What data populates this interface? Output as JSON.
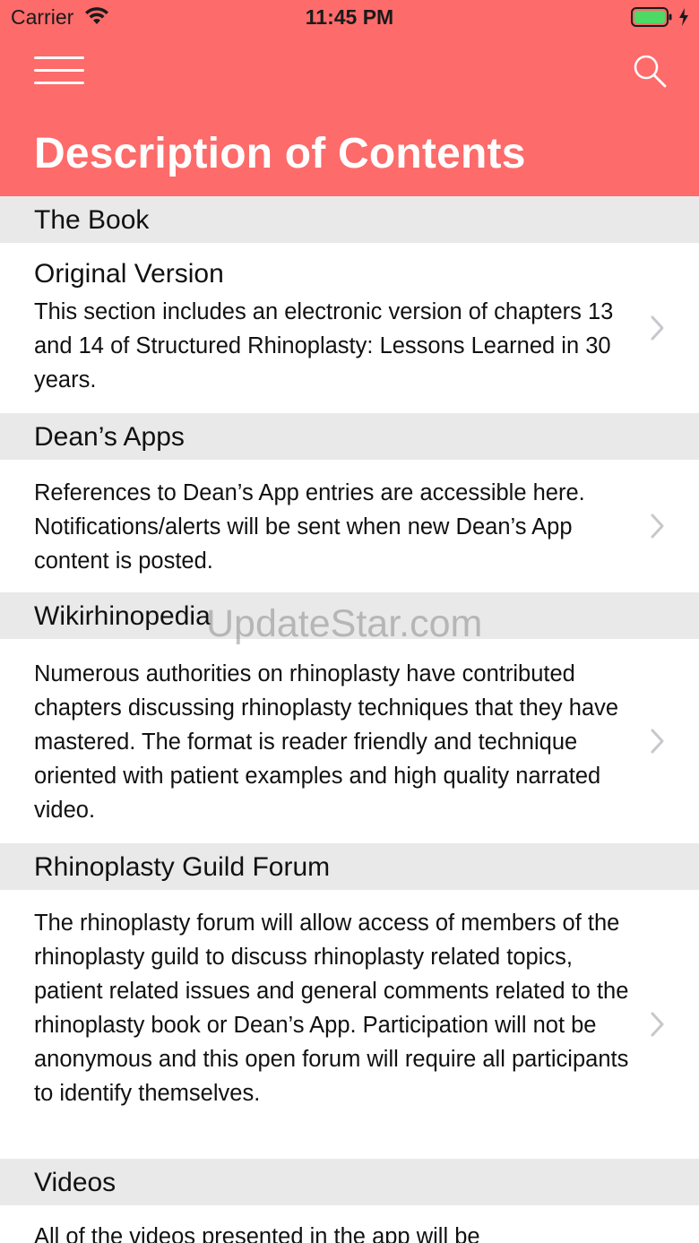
{
  "status_bar": {
    "carrier": "Carrier",
    "time": "11:45 PM"
  },
  "header": {
    "title": "Description of Contents"
  },
  "sections": [
    {
      "header": "The Book",
      "title": "Original Version",
      "description": "This section includes an electronic version of chapters 13 and 14 of Structured Rhinoplasty: Lessons Learned in 30 years."
    },
    {
      "header": "Dean’s Apps",
      "description": "References to Dean’s App entries are accessible here. Notifications/alerts will be sent when new Dean’s App content is posted."
    },
    {
      "header": "Wikirhinopedia",
      "description": "Numerous authorities on rhinoplasty have contributed chapters discussing rhinoplasty techniques that they have mastered. The format is reader friendly and technique oriented with patient examples and high quality narrated video."
    },
    {
      "header": "Rhinoplasty Guild Forum",
      "description": "The rhinoplasty forum will allow access of members of the rhinoplasty guild to discuss rhinoplasty related topics, patient related issues and general comments related to the rhinoplasty book or Dean’s App. Participation will not be anonymous and this open forum will require all participants to identify themselves."
    },
    {
      "header": "Videos",
      "description": "All of the videos presented in the app will be"
    }
  ],
  "watermark": "UpdateStar.com",
  "icons": {
    "menu": "hamburger-menu-icon",
    "search": "search-icon",
    "chevron": "chevron-right-icon",
    "wifi": "wifi-icon",
    "battery": "battery-icon"
  },
  "colors": {
    "header_bg": "#fd6b6a",
    "section_header_bg": "#e9e9e9",
    "battery_fill": "#4cd964",
    "chevron": "#c7c7cc"
  }
}
